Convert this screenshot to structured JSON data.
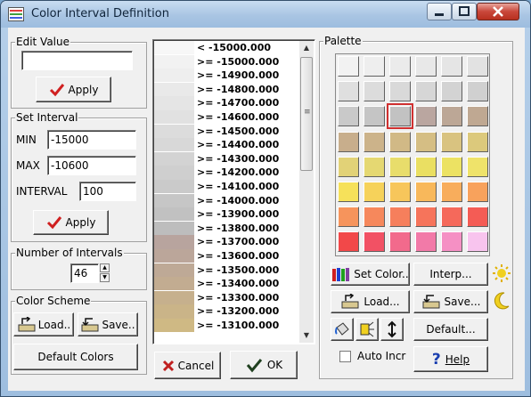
{
  "window": {
    "title": "Color Interval Definition"
  },
  "edit_value": {
    "label": "Edit Value",
    "value": "",
    "apply_label": "Apply"
  },
  "set_interval": {
    "label": "Set Interval",
    "min_label": "MIN",
    "min_value": "-15000",
    "max_label": "MAX",
    "max_value": "-10600",
    "interval_label": "INTERVAL",
    "interval_value": "100",
    "apply_label": "Apply"
  },
  "number_of_intervals": {
    "label": "Number of Intervals",
    "value": "46"
  },
  "color_scheme": {
    "label": "Color Scheme",
    "load_label": "Load..",
    "save_label": "Save..",
    "default_label": "Default Colors"
  },
  "intervals": [
    {
      "label": "<  -15000.000",
      "color": "#f7f7f7"
    },
    {
      "label": ">=  -15000.000",
      "color": "#f2f2f2"
    },
    {
      "label": ">=  -14900.000",
      "color": "#eeeeee"
    },
    {
      "label": ">=  -14800.000",
      "color": "#e9e9e9"
    },
    {
      "label": ">=  -14700.000",
      "color": "#e5e5e5"
    },
    {
      "label": ">=  -14600.000",
      "color": "#e1e1e1"
    },
    {
      "label": ">=  -14500.000",
      "color": "#dcdcdc"
    },
    {
      "label": ">=  -14400.000",
      "color": "#d8d8d8"
    },
    {
      "label": ">=  -14300.000",
      "color": "#d3d3d3"
    },
    {
      "label": ">=  -14200.000",
      "color": "#cfcfcf"
    },
    {
      "label": ">=  -14100.000",
      "color": "#cacaca"
    },
    {
      "label": ">=  -14000.000",
      "color": "#c6c6c6"
    },
    {
      "label": ">=  -13900.000",
      "color": "#c1c1c1"
    },
    {
      "label": ">=  -13800.000",
      "color": "#bdbdbd"
    },
    {
      "label": ">=  -13700.000",
      "color": "#b8a49e"
    },
    {
      "label": ">=  -13600.000",
      "color": "#bba69a"
    },
    {
      "label": ">=  -13500.000",
      "color": "#bea996"
    },
    {
      "label": ">=  -13400.000",
      "color": "#c2ac91"
    },
    {
      "label": ">=  -13300.000",
      "color": "#c6b08d"
    },
    {
      "label": ">=  -13200.000",
      "color": "#cab488"
    },
    {
      "label": ">=  -13100.000",
      "color": "#cfb984"
    }
  ],
  "palette": {
    "label": "Palette",
    "colors": [
      [
        "#f2f2f2",
        "#eeeeee",
        "#ebebeb",
        "#e8e8e8",
        "#e5e5e5",
        "#e2e2e2"
      ],
      [
        "#dfdfdf",
        "#dcdcdc",
        "#d9d9d9",
        "#d6d6d6",
        "#d3d3d3",
        "#d0d0d0"
      ],
      [
        "#c9c9c9",
        "#c5c5c5",
        "#c2c2c2",
        "#baa6a0",
        "#bca796",
        "#bfa892"
      ],
      [
        "#c8ae8c",
        "#ccb38a",
        "#d1b986",
        "#d5be84",
        "#d9c380",
        "#dcc97c"
      ],
      [
        "#e2d277",
        "#e5d872",
        "#e8dd6b",
        "#eadf62",
        "#ece263",
        "#efe36a"
      ],
      [
        "#f6e15a",
        "#f6d25a",
        "#f7c65b",
        "#f8b85b",
        "#f8ad5c",
        "#f8a25c"
      ],
      [
        "#f6945c",
        "#f6885c",
        "#f67f5c",
        "#f6745b",
        "#f5695b",
        "#f45c55"
      ],
      [
        "#f24849",
        "#f25164",
        "#f26a8c",
        "#f27aa8",
        "#f590c4",
        "#f8c4ee"
      ]
    ],
    "selected": "2,2",
    "set_color_label": "Set Color..",
    "interp_label": "Interp...",
    "load_label": "Load...",
    "save_label": "Save...",
    "default_label": "Default...",
    "auto_incr_label": "Auto Incr",
    "help_label": "Help"
  },
  "buttons": {
    "cancel_label": "Cancel",
    "ok_label": "OK"
  }
}
